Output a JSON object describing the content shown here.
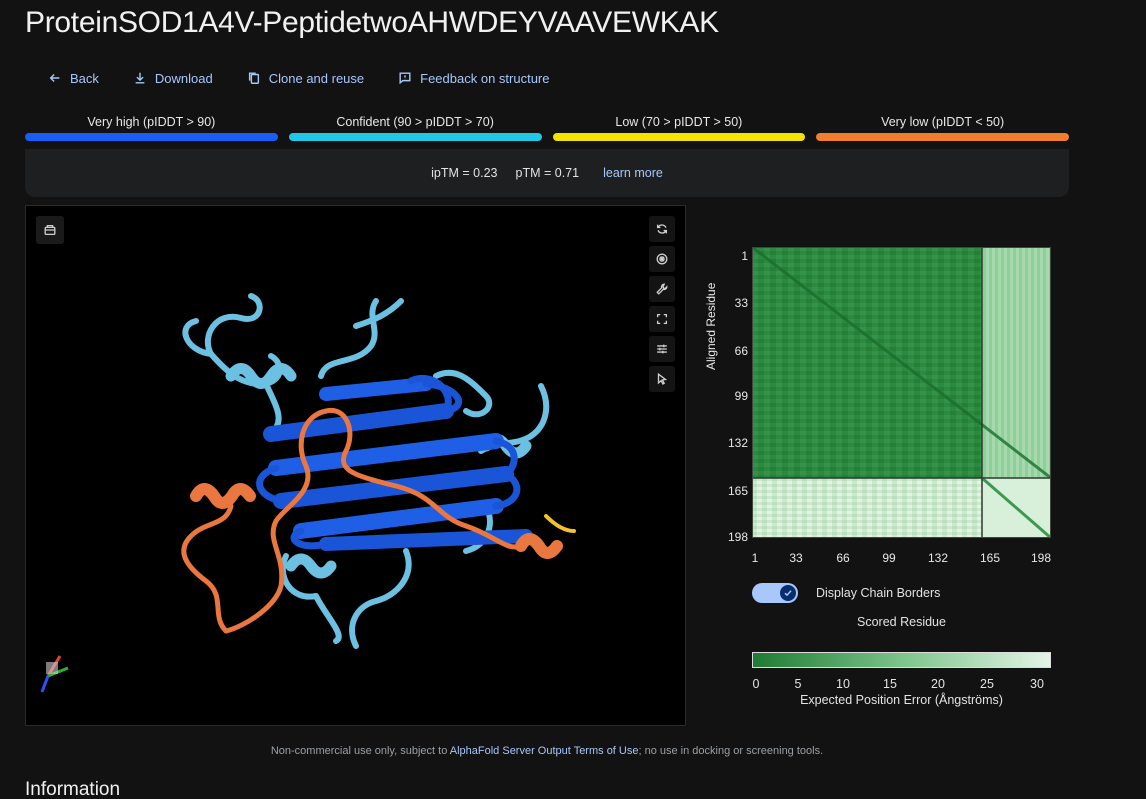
{
  "page": {
    "title": "ProteinSOD1A4V-PeptidetwoAHWDEYVAAVEWKAK"
  },
  "actions": [
    {
      "label": "Back",
      "icon": "arrow-left-icon"
    },
    {
      "label": "Download",
      "icon": "download-icon"
    },
    {
      "label": "Clone and reuse",
      "icon": "copy-icon"
    },
    {
      "label": "Feedback on structure",
      "icon": "feedback-icon"
    }
  ],
  "plddt_legend": [
    {
      "label": "Very high (pIDDT > 90)",
      "color": "#1a5ff5"
    },
    {
      "label": "Confident (90 > pIDDT > 70)",
      "color": "#22c7e8"
    },
    {
      "label": "Low (70 > pIDDT > 50)",
      "color": "#f4e200"
    },
    {
      "label": "Very low (pIDDT < 50)",
      "color": "#f07e2d"
    }
  ],
  "metrics": {
    "iptm": "ipTM = 0.23",
    "ptm": "pTM = 0.71",
    "learn_more": "learn more"
  },
  "viewer_tools": [
    "rotate-icon",
    "spin-icon",
    "wrench-icon",
    "fullscreen-icon",
    "settings-sliders-icon",
    "pointer-icon"
  ],
  "pae": {
    "y_axis_label": "Aligned Residue",
    "x_axis_label": "Scored Residue",
    "ticks": [
      "1",
      "33",
      "66",
      "99",
      "132",
      "165",
      "198"
    ],
    "toggle_label": "Display Chain Borders",
    "toggle_on": true,
    "colorbar_ticks": [
      "0",
      "5",
      "10",
      "15",
      "20",
      "25",
      "30"
    ],
    "colorbar_label": "Expected Position Error (Ångströms)"
  },
  "footer": {
    "before": "Non-commercial use only, subject to ",
    "link": "AlphaFold Server Output Terms of Use",
    "after": "; no use in docking or screening tools."
  },
  "section": {
    "information": "Information"
  }
}
